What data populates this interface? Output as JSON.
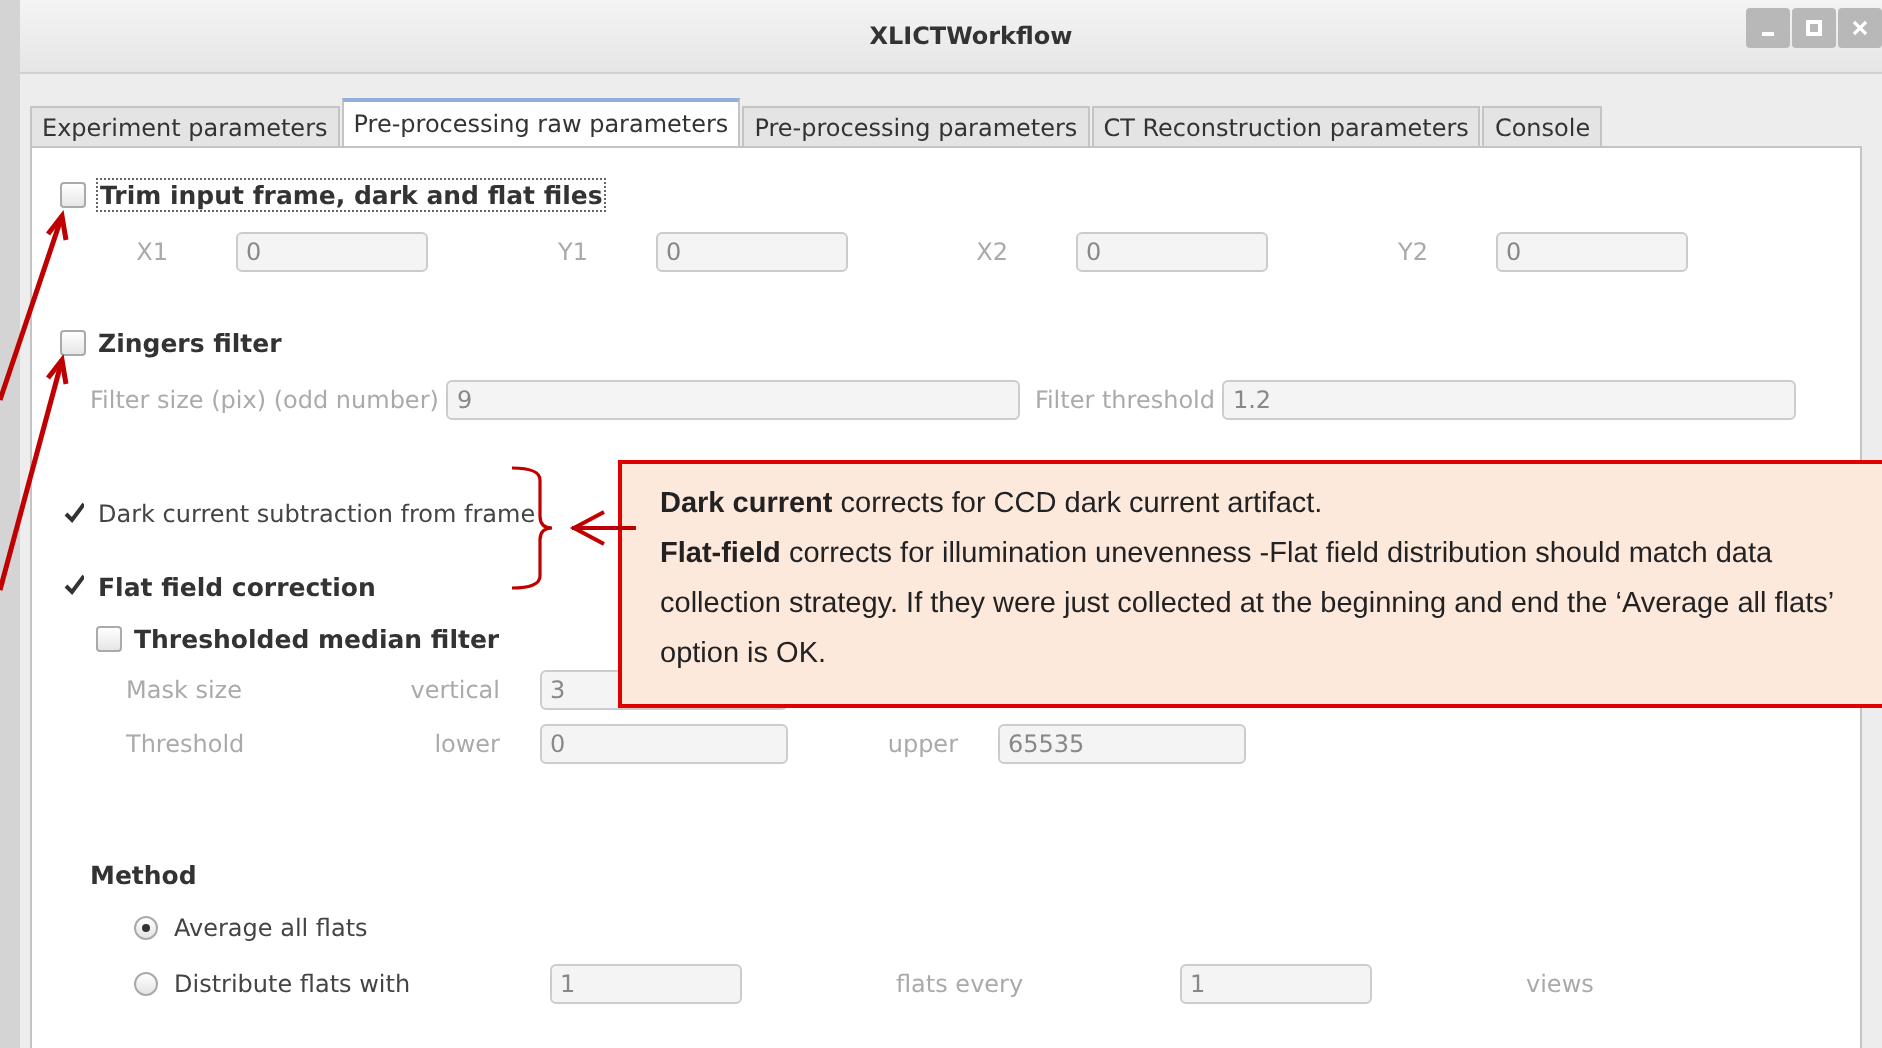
{
  "window": {
    "title": "XLICTWorkflow"
  },
  "tabs": [
    {
      "label": "Experiment parameters",
      "selected": false
    },
    {
      "label": "Pre-processing raw parameters",
      "selected": true
    },
    {
      "label": "Pre-processing parameters",
      "selected": false
    },
    {
      "label": "CT Reconstruction parameters",
      "selected": false
    },
    {
      "label": "Console",
      "selected": false
    }
  ],
  "trim": {
    "label": "Trim input frame, dark and flat files",
    "checked": false,
    "fields": [
      {
        "label": "X1",
        "value": "0"
      },
      {
        "label": "Y1",
        "value": "0"
      },
      {
        "label": "X2",
        "value": "0"
      },
      {
        "label": "Y2",
        "value": "0"
      }
    ]
  },
  "zingers": {
    "label": "Zingers filter",
    "checked": false,
    "fields": [
      {
        "label": "Filter size (pix) (odd number)",
        "value": "9"
      },
      {
        "label": "Filter threshold",
        "value": "1.2"
      }
    ]
  },
  "dark_current": {
    "label": "Dark current subtraction from frame",
    "checked": true
  },
  "flat_field": {
    "label": "Flat field correction",
    "checked": true
  },
  "median_filter": {
    "label": "Thresholded median filter",
    "checked": false,
    "rows": [
      {
        "label": "Mask size",
        "fields": [
          {
            "label": "vertical",
            "value": "3"
          }
        ]
      },
      {
        "label": "Threshold",
        "fields": [
          {
            "label": "lower",
            "value": "0"
          },
          {
            "label": "upper",
            "value": "65535"
          }
        ]
      }
    ]
  },
  "method": {
    "label": "Method",
    "options": [
      {
        "label": "Average all flats",
        "selected": true
      },
      {
        "label": "Distribute flats with",
        "selected": false,
        "items": [
          {
            "kind": "field",
            "value": "1"
          },
          {
            "kind": "text",
            "text": "flats every"
          },
          {
            "kind": "field",
            "value": "1"
          },
          {
            "kind": "text",
            "text": "views"
          }
        ]
      }
    ]
  },
  "callout": {
    "paragraphs": [
      "**Dark current** corrects for CCD dark current artifact.",
      "**Flat-field** corrects for illumination unevenness -Flat field distribution should match data collection strategy. If they were just collected at the beginning and end the ‘Average all flats’ option is OK."
    ]
  }
}
